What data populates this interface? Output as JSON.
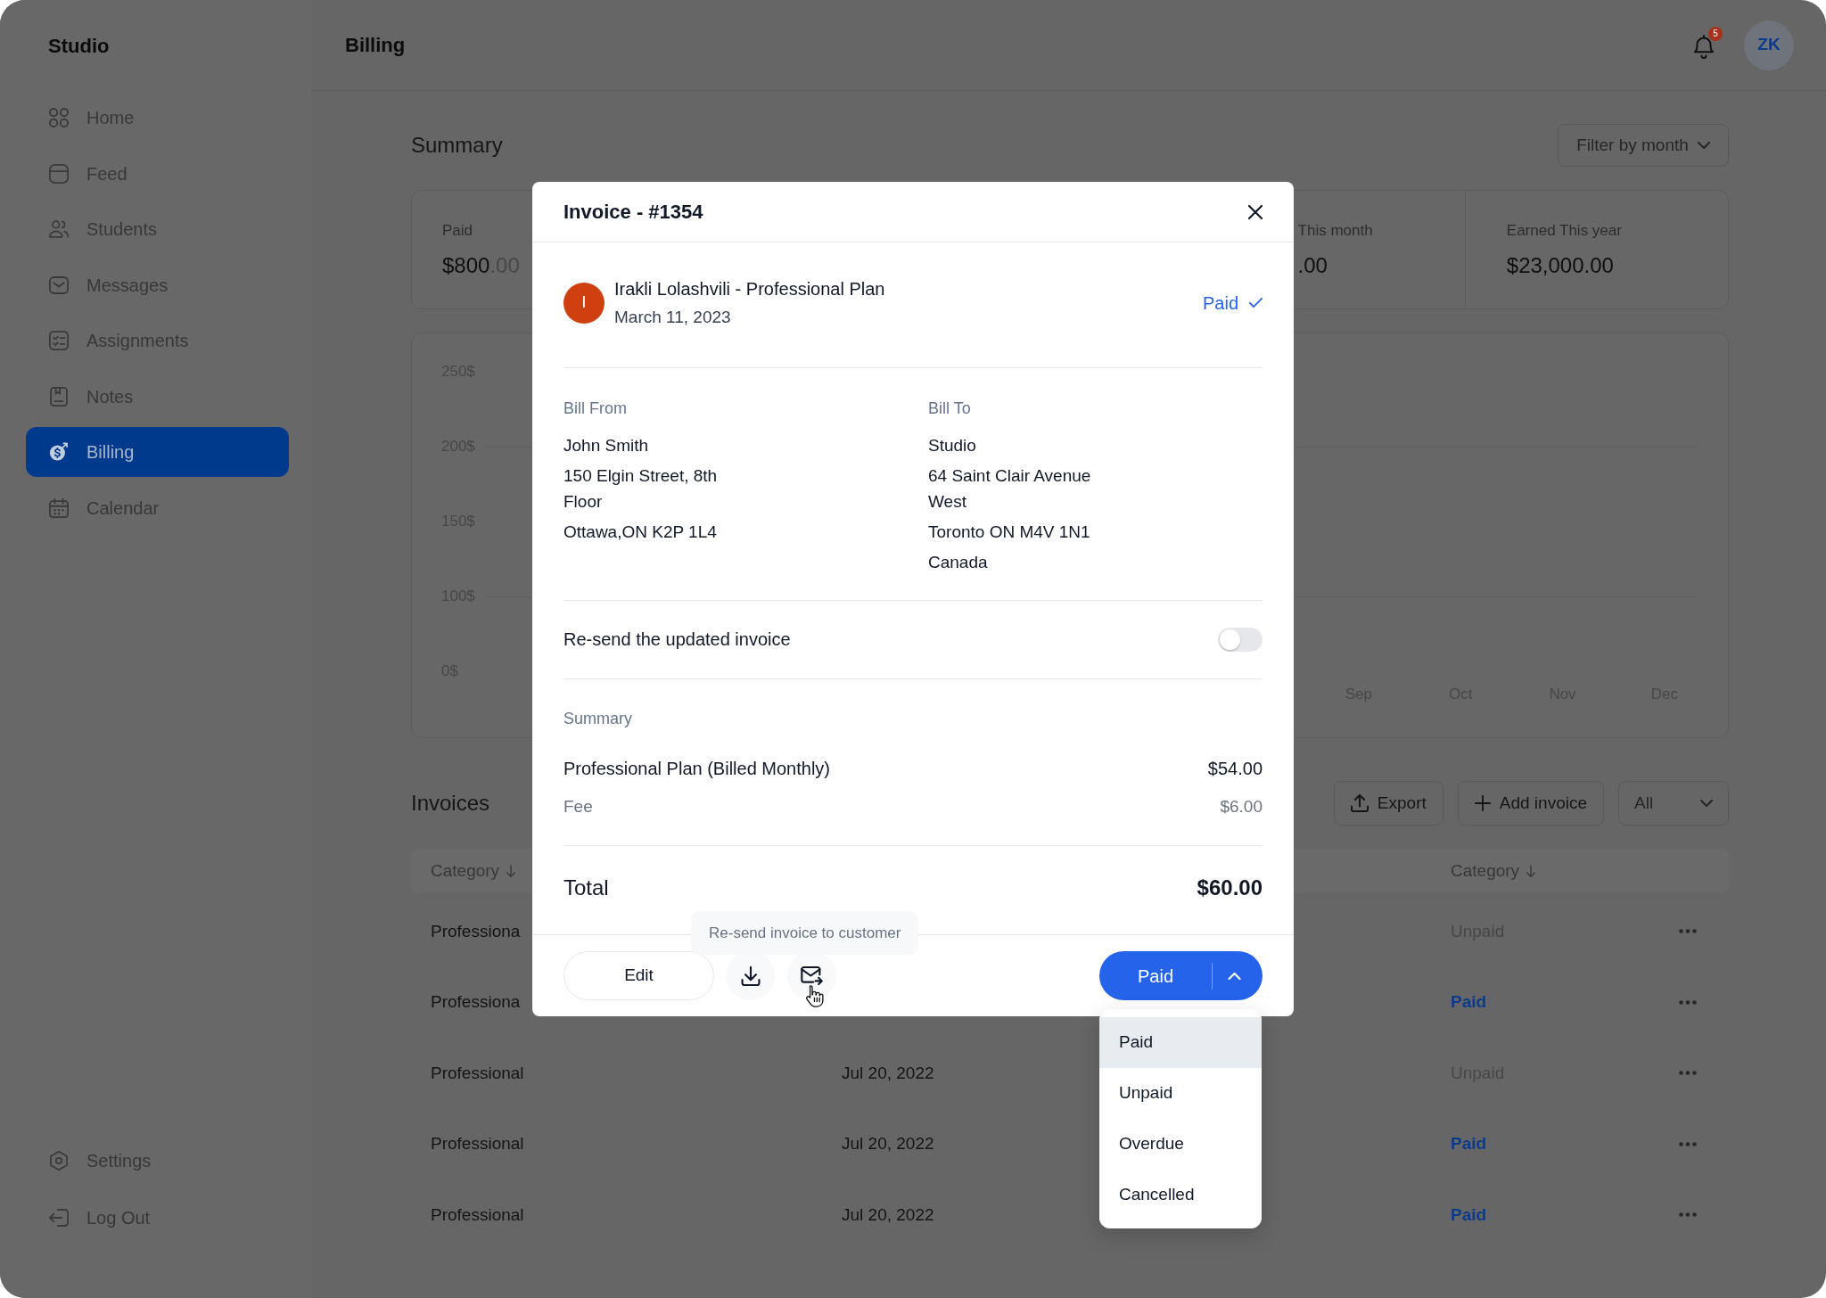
{
  "sidebar": {
    "brand": "Studio",
    "items": [
      {
        "label": "Home",
        "selected": false
      },
      {
        "label": "Feed",
        "selected": false
      },
      {
        "label": "Students",
        "selected": false
      },
      {
        "label": "Messages",
        "selected": false
      },
      {
        "label": "Assignments",
        "selected": false
      },
      {
        "label": "Notes",
        "selected": false
      },
      {
        "label": "Billing",
        "selected": true
      },
      {
        "label": "Calendar",
        "selected": false
      }
    ],
    "footer_items": [
      {
        "label": "Settings"
      },
      {
        "label": "Log Out"
      }
    ]
  },
  "header": {
    "title": "Billing",
    "notification_count": "5",
    "avatar": "ZK"
  },
  "summary": {
    "title": "Summary",
    "filter": "Filter by month",
    "cards": [
      {
        "label": "Paid",
        "value": "$800",
        "value_suffix": ".00"
      },
      {
        "label": "This month",
        "value": ".00"
      },
      {
        "label": "Earned This year",
        "value": "$23,000.00"
      }
    ]
  },
  "chart": {
    "y_labels": [
      "250$",
      "200$",
      "150$",
      "100$",
      "0$"
    ],
    "x_labels": [
      "Sep",
      "Oct",
      "Nov",
      "Dec"
    ]
  },
  "invoices": {
    "title": "Invoices",
    "actions": [
      {
        "label": "Export",
        "kind": "export"
      },
      {
        "label": "Add invoice",
        "kind": "add"
      }
    ],
    "filter": "All",
    "columns": [
      {
        "label": "Category"
      },
      {
        "label": "Category"
      }
    ],
    "rows": [
      {
        "category": "Professiona",
        "status": "Unpaid",
        "paid": false
      },
      {
        "category": "Professiona",
        "status": "Paid",
        "paid": true
      },
      {
        "category": "Professional",
        "date": "Jul 20, 2022",
        "status": "Unpaid",
        "paid": false
      },
      {
        "category": "Professional",
        "date": "Jul 20, 2022",
        "status": "Paid",
        "paid": true
      },
      {
        "category": "Professional",
        "date": "Jul 20, 2022",
        "status": "Paid",
        "paid": true
      }
    ]
  },
  "modal": {
    "title": "Invoice - #1354",
    "customer": {
      "initial": "I",
      "name": "Irakli Lolashvili - Professional Plan",
      "date": "March 11, 2023",
      "status": "Paid"
    },
    "bill_from": {
      "label": "Bill From",
      "lines": [
        "John Smith",
        "150 Elgin Street, 8th Floor",
        "Ottawa,ON K2P 1L4"
      ]
    },
    "bill_to": {
      "label": "Bill To",
      "lines": [
        "Studio",
        "64 Saint Clair Avenue West",
        "Toronto ON M4V 1N1",
        "Canada"
      ]
    },
    "resend": {
      "label": "Re-send the updated invoice",
      "on": false
    },
    "summary": {
      "title": "Summary",
      "items": [
        {
          "label": "Professional Plan (Billed Monthly)",
          "amount": "$54.00",
          "kind": "plan"
        },
        {
          "label": "Fee",
          "amount": "$6.00",
          "kind": "fee"
        }
      ],
      "total_label": "Total",
      "total": "$60.00"
    },
    "edit_button": "Edit",
    "tooltip": "Re-send invoice to customer",
    "status_button": {
      "label": "Paid",
      "expanded": true,
      "options": [
        {
          "label": "Paid",
          "selected": true
        },
        {
          "label": "Unpaid",
          "selected": false
        },
        {
          "label": "Overdue",
          "selected": false
        },
        {
          "label": "Cancelled",
          "selected": false
        }
      ]
    }
  }
}
